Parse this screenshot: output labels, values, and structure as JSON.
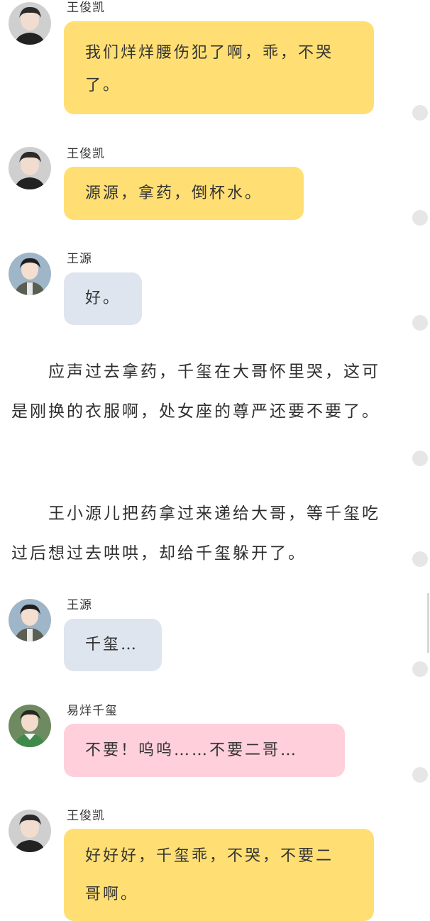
{
  "colors": {
    "yellow": "#ffdf74",
    "blue": "#dfe5ee",
    "pink": "#ffd0db"
  },
  "messages": [
    {
      "name": "王俊凯",
      "avatar": "avatar-wangjunkai",
      "text": "我们烊烊腰伤犯了啊，乖，不哭了。",
      "bubble": "yellow"
    },
    {
      "name": "王俊凯",
      "avatar": "avatar-wangjunkai",
      "text": "源源，拿药，倒杯水。",
      "bubble": "yellow"
    },
    {
      "name": "王源",
      "avatar": "avatar-wangyuan",
      "text": "好。",
      "bubble": "blue"
    },
    {
      "name": "王源",
      "avatar": "avatar-wangyuan",
      "text": "千玺…",
      "bubble": "blue"
    },
    {
      "name": "易烊千玺",
      "avatar": "avatar-yiyangqianxi",
      "text": "不要！呜呜……不要二哥…",
      "bubble": "pink"
    },
    {
      "name": "王俊凯",
      "avatar": "avatar-wangjunkai",
      "text": "好好好，千玺乖，不哭，不要二哥啊。",
      "bubble": "yellow"
    }
  ],
  "narration": [
    "　　应声过去拿药，千玺在大哥怀里哭，这可是刚换的衣服啊，处女座的尊严还要不要了。",
    "　　王小源儿把药拿过来递给大哥，等千玺吃过后想过去哄哄，却给千玺躲开了。"
  ]
}
